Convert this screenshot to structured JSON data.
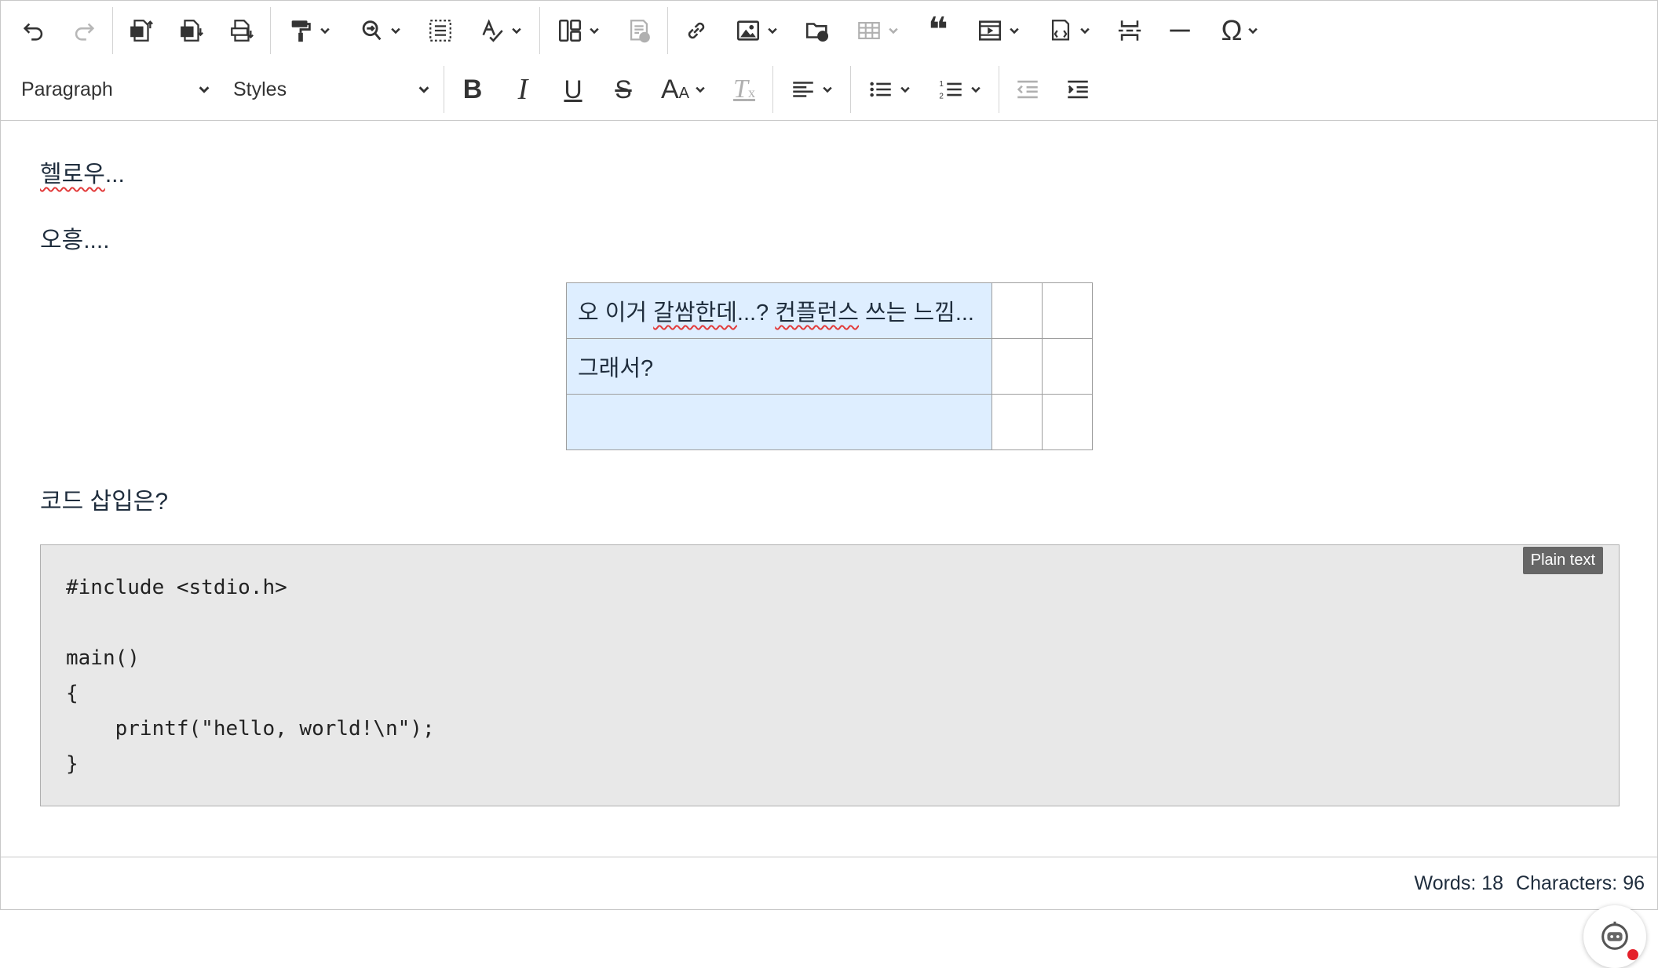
{
  "toolbar": {
    "paragraph_select": "Paragraph",
    "styles_select": "Styles",
    "buttons": [
      "undo",
      "redo",
      "import-word",
      "export-word",
      "export-pdf",
      "format-painter",
      "find-replace",
      "select-all",
      "spellcheck",
      "layout",
      "insert-template",
      "link",
      "image",
      "file-manager",
      "table",
      "block-quote",
      "media",
      "source-editing",
      "page-break",
      "horizontal-line",
      "special-characters",
      "bold",
      "italic",
      "underline",
      "strikethrough",
      "font-size",
      "remove-format",
      "alignment",
      "bulleted-list",
      "numbered-list",
      "outdent",
      "indent"
    ]
  },
  "content": {
    "paragraph1": "헬로우...",
    "paragraph1_spell": "헬로우",
    "paragraph1_rest": "...",
    "paragraph2": "오흥....",
    "table": {
      "row1": {
        "t1": "오 이거 ",
        "s1": "갈쌈한데",
        "t2": "...? ",
        "s2": "컨플런스",
        "t3": " 쓰는 느낌..."
      },
      "row2": "그래서?",
      "row3": ""
    },
    "paragraph3": "코드 삽입은?",
    "code_language": "Plain text",
    "code": "#include <stdio.h>\n\nmain()\n{\n    printf(\"hello, world!\\n\");\n}"
  },
  "footer": {
    "words": "Words: 18",
    "characters": "Characters: 96"
  }
}
